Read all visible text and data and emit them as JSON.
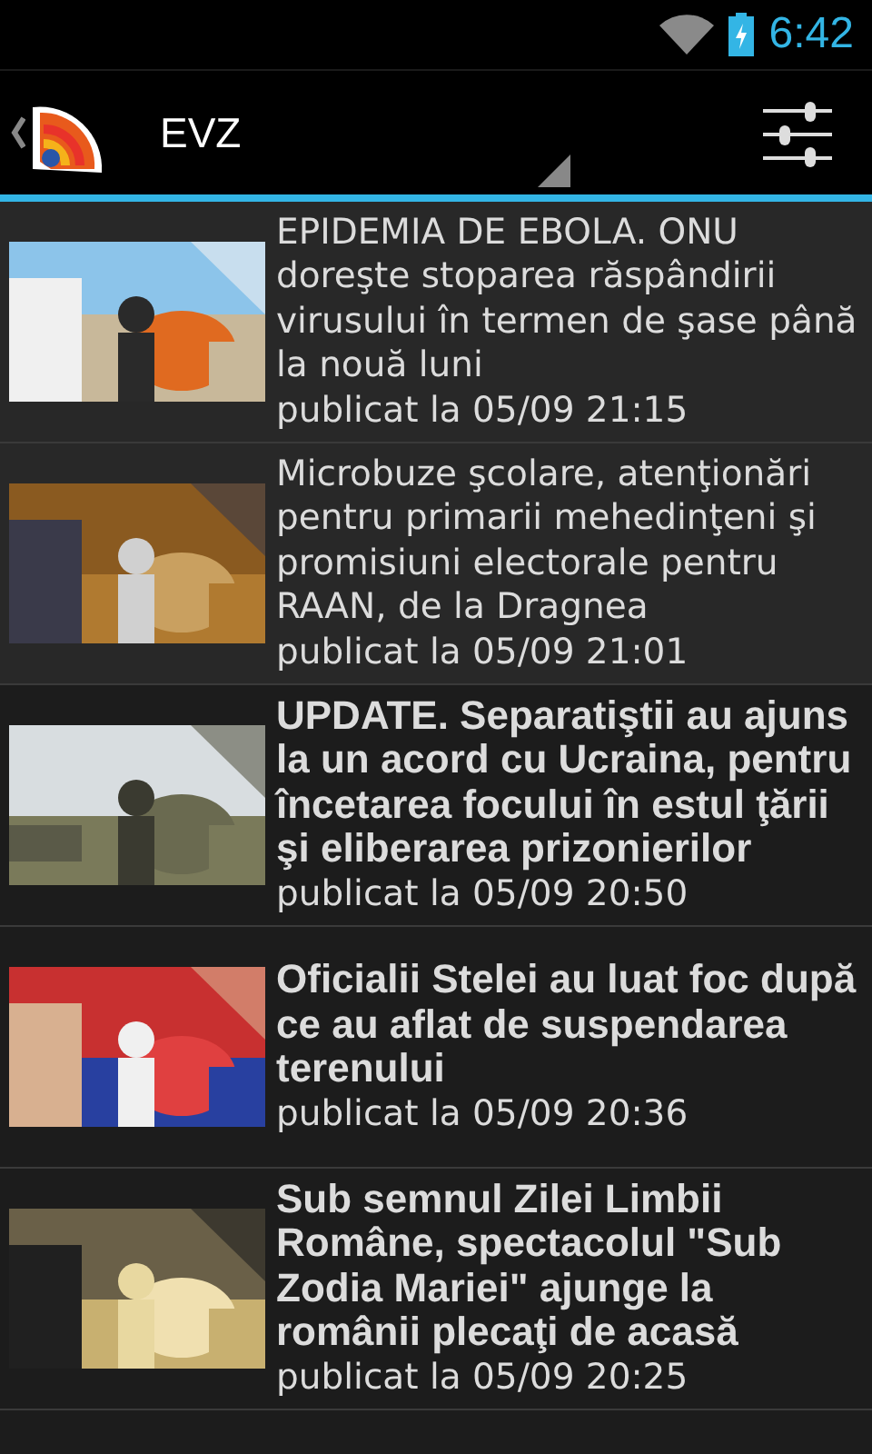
{
  "status_bar": {
    "time": "6:42"
  },
  "action_bar": {
    "title": "EVZ"
  },
  "articles": [
    {
      "title": "EPIDEMIA DE EBOLA. ONU doreşte stoparea răspândirii virusului în termen de şase până la nouă luni",
      "published": "publicat la 05/09 21:15",
      "read": true
    },
    {
      "title": "Microbuze şcolare, atenţionări pentru primarii mehedinţeni şi promisiuni electorale pentru RAAN, de la Dragnea",
      "published": "publicat la 05/09 21:01",
      "read": true
    },
    {
      "title": "UPDATE. Separatiştii au ajuns la un acord cu Ucraina, pentru încetarea focului în estul ţării şi eliberarea prizonierilor",
      "published": "publicat la 05/09 20:50",
      "read": false
    },
    {
      "title": "Oficialii Stelei au luat foc după ce au aflat de suspendarea terenului",
      "published": "publicat la 05/09 20:36",
      "read": false
    },
    {
      "title": "Sub semnul Zilei Limbii Române, spectacolul \"Sub Zodia Mariei\" ajunge la românii plecaţi de acasă",
      "published": "publicat la 05/09 20:25",
      "read": false
    }
  ]
}
